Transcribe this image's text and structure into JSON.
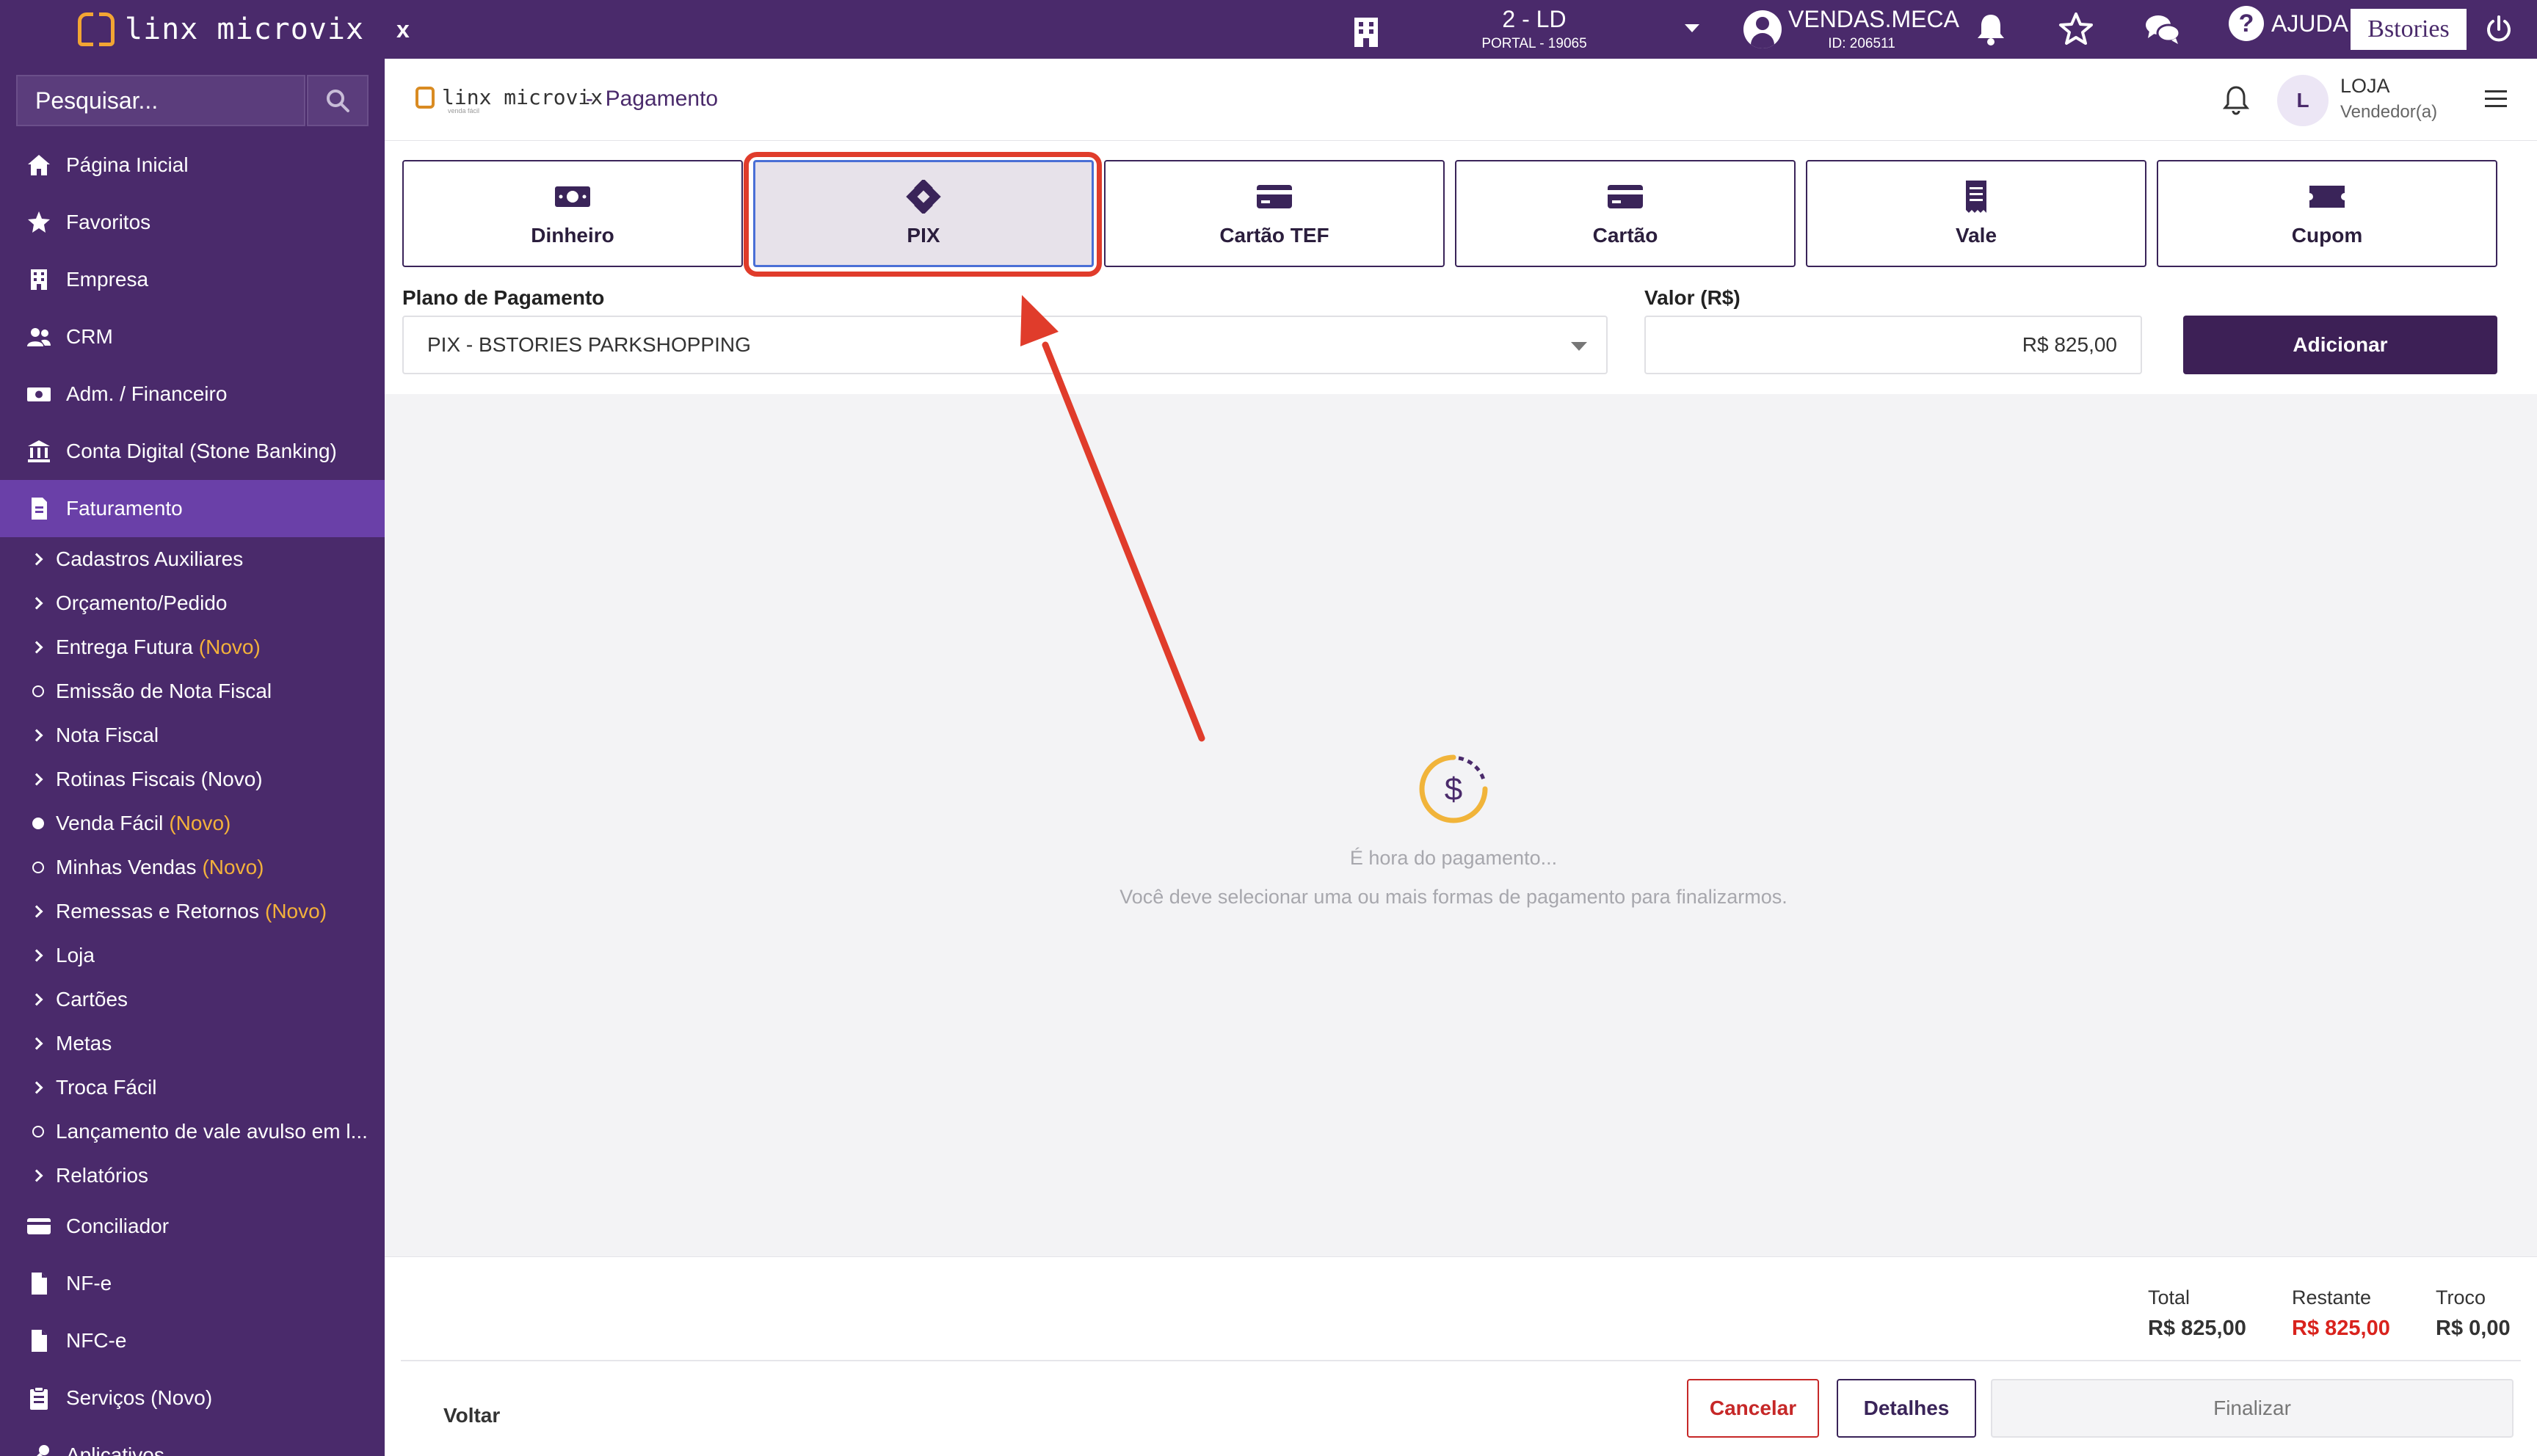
{
  "topbar": {
    "brand": "linx microvix",
    "close_label": "x",
    "store": "2 - LD",
    "store_sub": "PORTAL - 19065",
    "user": "VENDAS.MECA",
    "user_id": "ID: 206511",
    "help_label": "AJUDA",
    "brand_badge": "Bstories"
  },
  "sidebar": {
    "search_placeholder": "Pesquisar...",
    "items_top": [
      {
        "label": "Página Inicial",
        "icon": "home-icon"
      },
      {
        "label": "Favoritos",
        "icon": "star-icon"
      },
      {
        "label": "Empresa",
        "icon": "building-icon"
      },
      {
        "label": "CRM",
        "icon": "people-icon"
      },
      {
        "label": "Adm. / Financeiro",
        "icon": "money-icon"
      },
      {
        "label": "Conta Digital (Stone Banking)",
        "icon": "bank-icon"
      },
      {
        "label": "Faturamento",
        "icon": "invoice-icon"
      }
    ],
    "sub_items": [
      {
        "label": "Cadastros Auxiliares",
        "marker": "chevron",
        "badge": ""
      },
      {
        "label": "Orçamento/Pedido",
        "marker": "chevron",
        "badge": ""
      },
      {
        "label": "Entrega Futura",
        "marker": "chevron",
        "badge": "(Novo)"
      },
      {
        "label": "Emissão de Nota Fiscal",
        "marker": "circle",
        "badge": ""
      },
      {
        "label": "Nota Fiscal",
        "marker": "chevron",
        "badge": ""
      },
      {
        "label": "Rotinas Fiscais (Novo)",
        "marker": "chevron",
        "badge": ""
      },
      {
        "label": "Venda Fácil",
        "marker": "dot",
        "badge": "(Novo)"
      },
      {
        "label": "Minhas Vendas",
        "marker": "circle",
        "badge": "(Novo)"
      },
      {
        "label": "Remessas e Retornos",
        "marker": "chevron",
        "badge": "(Novo)"
      },
      {
        "label": "Loja",
        "marker": "chevron",
        "badge": ""
      },
      {
        "label": "Cartões",
        "marker": "chevron",
        "badge": ""
      },
      {
        "label": "Metas",
        "marker": "chevron",
        "badge": ""
      },
      {
        "label": "Troca Fácil",
        "marker": "chevron",
        "badge": ""
      },
      {
        "label": "Lançamento de vale avulso em l...",
        "marker": "circle",
        "badge": ""
      },
      {
        "label": "Relatórios",
        "marker": "chevron",
        "badge": ""
      }
    ],
    "items_bottom": [
      {
        "label": "Conciliador",
        "icon": "card-icon"
      },
      {
        "label": "NF-e",
        "icon": "file-icon"
      },
      {
        "label": "NFC-e",
        "icon": "file-icon"
      },
      {
        "label": "Serviços (Novo)",
        "icon": "clipboard-icon"
      },
      {
        "label": "Aplicativos",
        "icon": "tools-icon"
      }
    ]
  },
  "header": {
    "brand": "linx microvix",
    "brand_sub": "venda fácil",
    "title_sep": "-",
    "title": "Pagamento",
    "avatar_initial": "L",
    "role_name": "LOJA",
    "role_sub": "Vendedor(a)"
  },
  "payment_methods": [
    {
      "label": "Dinheiro",
      "icon": "cash-icon",
      "selected": false
    },
    {
      "label": "PIX",
      "icon": "pix-icon",
      "selected": true
    },
    {
      "label": "Cartão TEF",
      "icon": "card-icon",
      "selected": false
    },
    {
      "label": "Cartão",
      "icon": "card-icon",
      "selected": false
    },
    {
      "label": "Vale",
      "icon": "receipt-icon",
      "selected": false
    },
    {
      "label": "Cupom",
      "icon": "ticket-icon",
      "selected": false
    }
  ],
  "form": {
    "plan_label": "Plano de Pagamento",
    "plan_value": "PIX - BSTORIES PARKSHOPPING",
    "value_label": "Valor (R$)",
    "value_amount": "R$ 825,00",
    "add_label": "Adicionar"
  },
  "empty_state": {
    "title": "É hora do pagamento...",
    "description": "Você deve selecionar uma ou mais formas de pagamento para finalizarmos."
  },
  "totals": {
    "total_label": "Total",
    "total_value": "R$ 825,00",
    "remaining_label": "Restante",
    "remaining_value": "R$ 825,00",
    "change_label": "Troco",
    "change_value": "R$ 0,00"
  },
  "footer": {
    "back_label": "Voltar",
    "cancel_label": "Cancelar",
    "details_label": "Detalhes",
    "finish_label": "Finalizar"
  },
  "colors": {
    "primary": "#4a2a6b",
    "accent": "#f3b13b",
    "annotation": "#e03c2b",
    "danger": "#d9231d"
  }
}
